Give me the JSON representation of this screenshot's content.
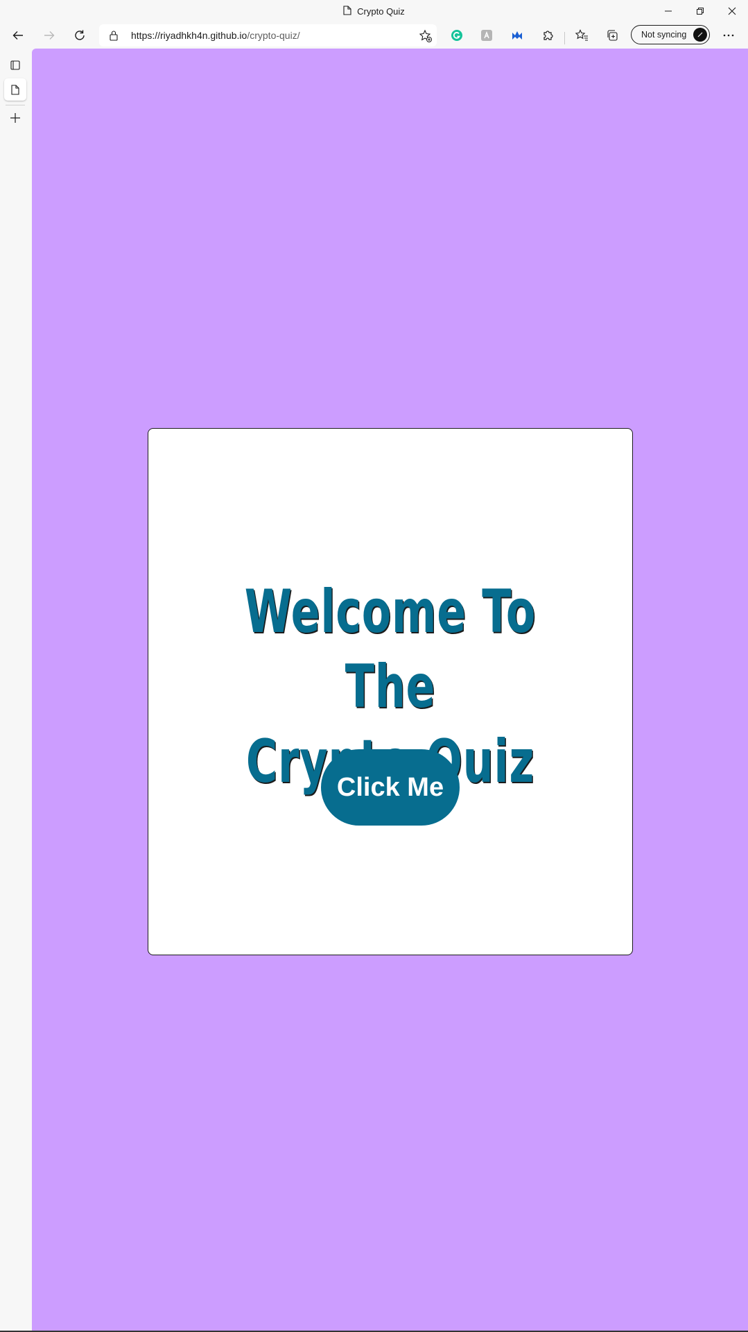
{
  "window": {
    "title": "Crypto Quiz",
    "controls": [
      "minimize",
      "restore",
      "close"
    ]
  },
  "toolbar": {
    "url_host": "https://riyadhkh4n.github.io",
    "url_path": "/crypto-quiz/",
    "sync_label": "Not syncing",
    "extensions": [
      "grammarly-icon",
      "extension-icon",
      "malwarebytes-icon",
      "puzzle-icon"
    ]
  },
  "sidebar": {
    "items": [
      "tab-actions-icon",
      "page-icon",
      "plus-icon"
    ]
  },
  "page": {
    "background": "#cc9dff",
    "card_background": "#ffffff",
    "heading_line1": "Welcome To The",
    "heading_line2": "Crypto Quiz",
    "heading_color": "#076d8f",
    "button_label": "Click Me",
    "button_color": "#076d8f"
  }
}
